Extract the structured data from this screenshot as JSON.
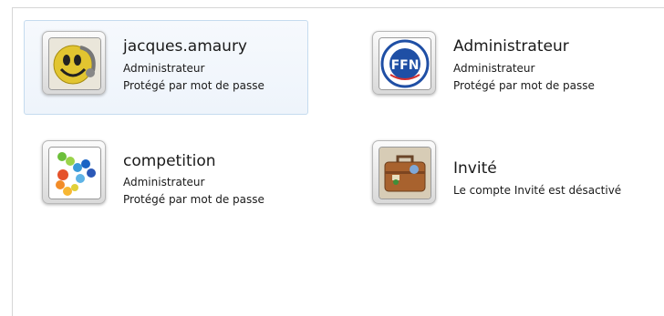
{
  "accounts": [
    {
      "name": "jacques.amaury",
      "role": "Administrateur",
      "status": "Protégé par mot de passe",
      "avatar": "smiley-headset-icon"
    },
    {
      "name": "Administrateur",
      "role": "Administrateur",
      "status": "Protégé par mot de passe",
      "avatar": "ffn-logo-icon"
    },
    {
      "name": "competition",
      "role": "Administrateur",
      "status": "Protégé par mot de passe",
      "avatar": "colored-beads-icon"
    },
    {
      "name": "Invité",
      "status": "Le compte Invité est désactivé",
      "avatar": "suitcase-icon"
    }
  ],
  "colors": {
    "selection_border": "#c5dbef",
    "selection_bg": "#f0f5fb"
  }
}
